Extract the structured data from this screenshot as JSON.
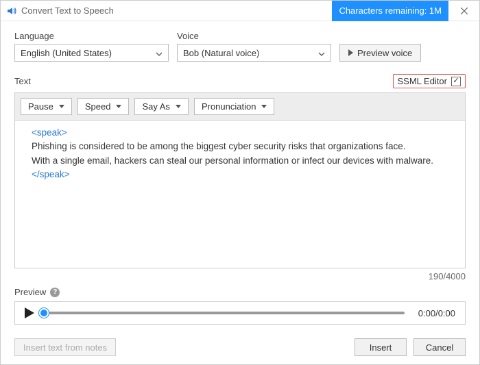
{
  "titlebar": {
    "title": "Convert Text to Speech",
    "chars_remaining": "Characters remaining: 1M"
  },
  "labels": {
    "language": "Language",
    "voice": "Voice",
    "text": "Text",
    "preview": "Preview"
  },
  "language_value": "English (United States)",
  "voice_value": "Bob (Natural voice)",
  "buttons": {
    "preview_voice": "Preview voice",
    "ssml_editor": "SSML Editor",
    "insert_from_notes": "Insert text from notes",
    "insert": "Insert",
    "cancel": "Cancel"
  },
  "toolbar": {
    "pause": "Pause",
    "speed": "Speed",
    "say_as": "Say As",
    "pronunciation": "Pronunciation"
  },
  "editor": {
    "open_tag": "<speak>",
    "line1": "Phishing is considered to be among the biggest cyber security risks that organizations face.",
    "line2": "With a single email, hackers can steal our personal information or infect our devices with malware.",
    "close_tag": "</speak>"
  },
  "counter": "190/4000",
  "player_time": "0:00/0:00"
}
